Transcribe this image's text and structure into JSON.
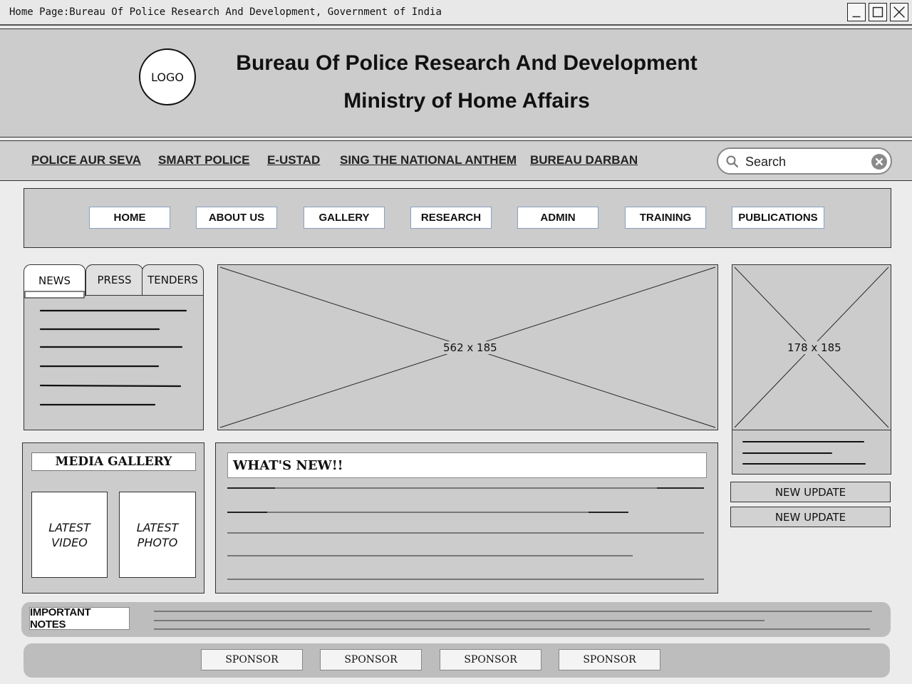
{
  "window": {
    "title": "Home Page:Bureau Of Police Research And Development, Government of India",
    "controls": [
      "minimize",
      "maximize",
      "close"
    ]
  },
  "header": {
    "logo_label": "LOGO",
    "title_line1": "Bureau Of Police Research And Development",
    "title_line2": "Ministry of Home Affairs"
  },
  "top_links": [
    "POLICE AUR SEVA",
    "SMART POLICE",
    "E-USTAD",
    "SING THE NATIONAL ANTHEM",
    "BUREAU DARBAN"
  ],
  "search": {
    "placeholder": "Search",
    "value": ""
  },
  "main_nav": [
    "HOME",
    "ABOUT US",
    "GALLERY",
    "RESEARCH",
    "ADMIN",
    "TRAINING",
    "PUBLICATIONS"
  ],
  "news_tabs": {
    "tabs": [
      "NEWS",
      "PRESS",
      "TENDERS"
    ],
    "active": "NEWS"
  },
  "main_image": {
    "label": "562 x 185"
  },
  "side_image": {
    "label": "178 x 185"
  },
  "media_gallery": {
    "title": "MEDIA GALLERY",
    "cards": [
      "LATEST VIDEO",
      "LATEST PHOTO"
    ]
  },
  "whats_new": {
    "title": "WHAT'S NEW!!"
  },
  "updates": [
    "NEW UPDATE",
    "NEW UPDATE"
  ],
  "important_notes": {
    "label": "IMPORTANT NOTES"
  },
  "sponsors": [
    "SPONSOR",
    "SPONSOR",
    "SPONSOR",
    "SPONSOR"
  ],
  "colors": {
    "panel": "#cccccc",
    "page": "#ececec",
    "border": "#333333"
  }
}
